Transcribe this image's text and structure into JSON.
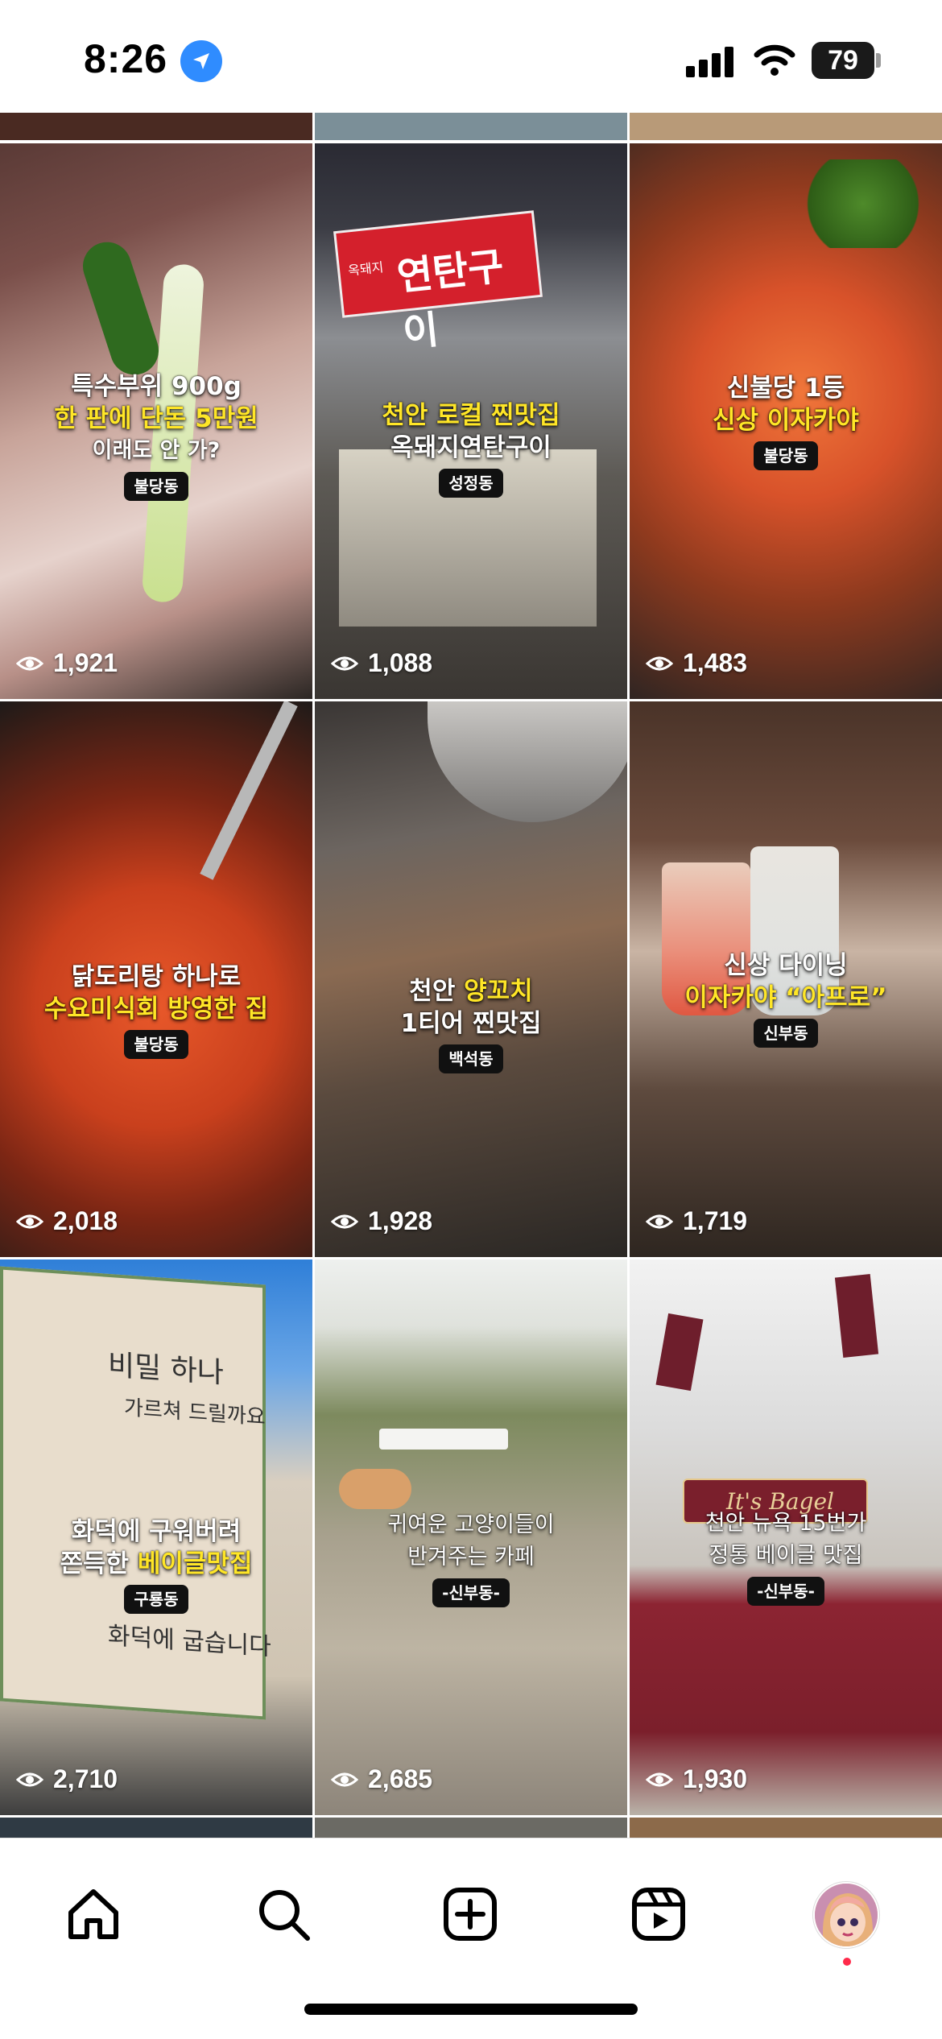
{
  "status": {
    "time": "8:26",
    "battery": "79",
    "location_icon": "location-arrow-icon"
  },
  "grid": {
    "tiles": [
      {
        "line1": "특수부위 900g",
        "line2": "한 판에 단돈 5만원",
        "line3": "이래도 안 가?",
        "tag": "불당동",
        "views": "1,921"
      },
      {
        "line1": "천안 로컬 찐맛집",
        "line2": "옥돼지연탄구이",
        "tag": "성정동",
        "views": "1,088",
        "sign": "연탄구이",
        "sign_small": "옥돼지"
      },
      {
        "line1": "신불당 1등",
        "line2": "신상 이자카야",
        "tag": "불당동",
        "views": "1,483"
      },
      {
        "line1": "닭도리탕 하나로",
        "line2": "수요미식회 방영한 집",
        "tag": "불당동",
        "views": "2,018"
      },
      {
        "line1": "천안",
        "line1b": "양꼬치",
        "line2": "1티어 찐맛집",
        "tag": "백석동",
        "views": "1,928"
      },
      {
        "line1": "신상 다이닝",
        "line2": "이자카야 “아프로”",
        "tag": "신부동",
        "views": "1,719"
      },
      {
        "line1": "화덕에 구워버려",
        "line2a": "쫀득한",
        "line2b": "베이글맛집",
        "tag": "구룡동",
        "views": "2,710",
        "banner1": "비밀 하나",
        "banner2": "가르쳐 드릴까요",
        "banner3": "화덕에 굽습니다"
      },
      {
        "line1": "귀여운 고양이들이",
        "line2": "반겨주는 카페",
        "tag": "-신부동-",
        "views": "2,685"
      },
      {
        "line1": "천안 뉴욕 15번가",
        "line2": "정통 베이글 맛집",
        "tag": "-신부동-",
        "views": "1,930",
        "sign": "It's Bagel"
      }
    ]
  },
  "tabbar": {
    "items": [
      "home-icon",
      "search-icon",
      "create-icon",
      "reels-icon",
      "profile-avatar"
    ]
  }
}
